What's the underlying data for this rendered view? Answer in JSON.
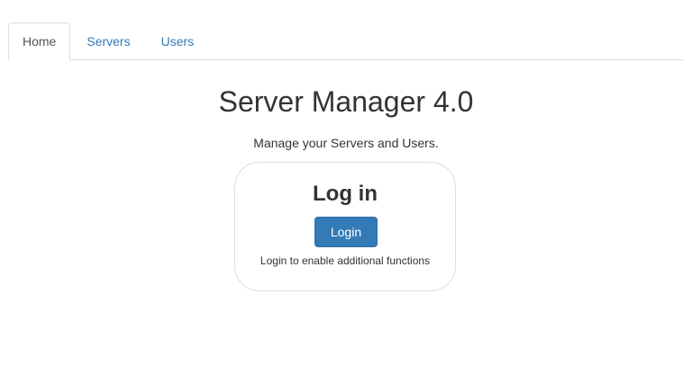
{
  "tabs": [
    {
      "label": "Home",
      "active": true
    },
    {
      "label": "Servers",
      "active": false
    },
    {
      "label": "Users",
      "active": false
    }
  ],
  "header": {
    "title": "Server Manager 4.0",
    "subtitle": "Manage your Servers and Users."
  },
  "login_card": {
    "title": "Log in",
    "button_label": "Login",
    "note": "Login to enable additional functions"
  },
  "colors": {
    "link": "#337ab7",
    "primary_button": "#337ab7",
    "border": "#dddddd",
    "text": "#333333"
  }
}
